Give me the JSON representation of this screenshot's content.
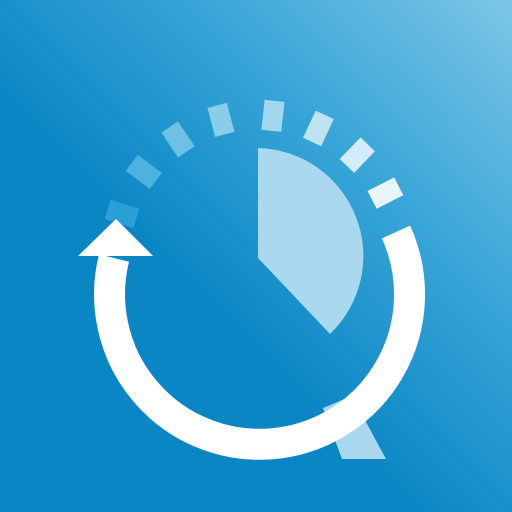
{
  "icon": {
    "name": "history-search-app-icon",
    "description_terms": [
      "clock-sector",
      "circular-arrow",
      "magnifier-handle",
      "tick-marks"
    ],
    "colors": {
      "background_light": "#7cc6e6",
      "background_mid": "#3aa6d8",
      "background_dark": "#0a86c4",
      "arrow": "#ffffff",
      "sector": "#a9d8ef",
      "handle": "#a9d8ef",
      "ticks": [
        "#2aa0d6",
        "#4eb2de",
        "#6ec1e5",
        "#8acde9",
        "#a3d7ee",
        "#bde2f2",
        "#d4ecf7",
        "#e8f5fb"
      ]
    }
  }
}
